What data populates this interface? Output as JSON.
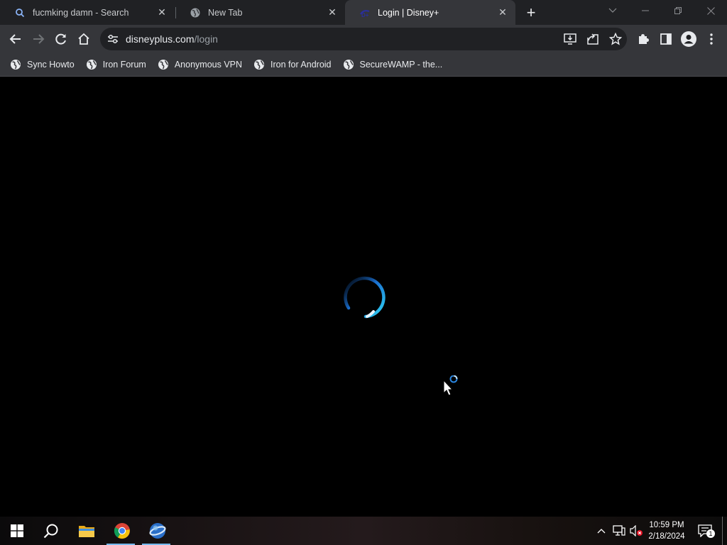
{
  "browser": {
    "tabs": [
      {
        "title": "fucmking damn - Search",
        "icon": "search-icon",
        "active": false
      },
      {
        "title": "New Tab",
        "icon": "globe-icon",
        "active": false
      },
      {
        "title": "Login | Disney+",
        "icon": "disney-favicon",
        "active": true
      }
    ],
    "new_tab_symbol": "+",
    "address": {
      "host": "disneyplus.com",
      "path": "/login"
    },
    "bookmarks": [
      {
        "label": "Sync Howto",
        "icon": "globe-icon"
      },
      {
        "label": "Iron Forum",
        "icon": "globe-icon"
      },
      {
        "label": "Anonymous VPN",
        "icon": "globe-icon"
      },
      {
        "label": "Iron for Android",
        "icon": "globe-icon"
      },
      {
        "label": "SecureWAMP - the...",
        "icon": "globe-icon"
      }
    ]
  },
  "page": {
    "state": "loading",
    "spinner_color": "#1ab2e8",
    "background": "#000000"
  },
  "taskbar": {
    "apps": [
      "windows-start-icon",
      "search-icon",
      "file-explorer-icon",
      "chrome-icon",
      "iron-browser-icon"
    ],
    "clock": {
      "time": "10:59 PM",
      "date": "2/18/2024"
    },
    "notification_count": "1"
  },
  "colors": {
    "tabstrip": "#202124",
    "toolbar": "#35363a",
    "accent": "#76b9ed"
  }
}
